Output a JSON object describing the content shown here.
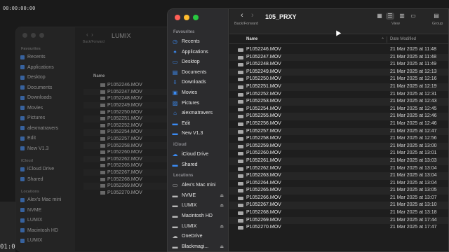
{
  "background": {
    "timecode_top": "00:00:00:00",
    "timecode_bottom": "01:0"
  },
  "back_window": {
    "title": "LUMIX",
    "back_forward_label": "Back/Forward",
    "column_name": "Name",
    "sidebar": [
      {
        "type": "head",
        "label": "Favourites"
      },
      {
        "type": "item",
        "label": "Recents"
      },
      {
        "type": "item",
        "label": "Applications"
      },
      {
        "type": "item",
        "label": "Desktop"
      },
      {
        "type": "item",
        "label": "Documents"
      },
      {
        "type": "item",
        "label": "Downloads"
      },
      {
        "type": "item",
        "label": "Movies"
      },
      {
        "type": "item",
        "label": "Pictures"
      },
      {
        "type": "item",
        "label": "alexmatravers"
      },
      {
        "type": "item",
        "label": "Edit"
      },
      {
        "type": "item",
        "label": "New V1.3"
      },
      {
        "type": "head",
        "label": "iCloud"
      },
      {
        "type": "item",
        "label": "iCloud Drive"
      },
      {
        "type": "item",
        "label": "Shared"
      },
      {
        "type": "head",
        "label": "Locations"
      },
      {
        "type": "item",
        "label": "Alex's Mac mini"
      },
      {
        "type": "item",
        "label": "NVME"
      },
      {
        "type": "item",
        "label": "LUMIX"
      },
      {
        "type": "item",
        "label": "Macintosh HD"
      },
      {
        "type": "item",
        "label": "LUMIX"
      }
    ],
    "files": [
      "P1052246.MOV",
      "P1052247.MOV",
      "P1052248.MOV",
      "P1052249.MOV",
      "P1052250.MOV",
      "P1052251.MOV",
      "P1052252.MOV",
      "P1052254.MOV",
      "P1052257.MOV",
      "P1052258.MOV",
      "P1052260.MOV",
      "P1052262.MOV",
      "P1052265.MOV",
      "P1052267.MOV",
      "P1052268.MOV",
      "P1052269.MOV",
      "P1052270.MOV"
    ]
  },
  "front_window": {
    "title": "105_PRXY",
    "back_forward_label": "Back/Forward",
    "view_label": "View",
    "group_label": "Group",
    "column_name": "Name",
    "column_date": "Date Modified",
    "sidebar": {
      "favourites_head": "Favourites",
      "favourites": [
        {
          "label": "Recents",
          "icon": "clock-icon"
        },
        {
          "label": "Applications",
          "icon": "applications-icon"
        },
        {
          "label": "Desktop",
          "icon": "desktop-icon"
        },
        {
          "label": "Documents",
          "icon": "document-icon"
        },
        {
          "label": "Downloads",
          "icon": "download-icon"
        },
        {
          "label": "Movies",
          "icon": "film-icon"
        },
        {
          "label": "Pictures",
          "icon": "picture-icon"
        },
        {
          "label": "alexmatravers",
          "icon": "home-icon"
        },
        {
          "label": "Edit",
          "icon": "folder-icon"
        },
        {
          "label": "New V1.3",
          "icon": "folder-icon"
        }
      ],
      "icloud_head": "iCloud",
      "icloud": [
        {
          "label": "iCloud Drive",
          "icon": "cloud-icon"
        },
        {
          "label": "Shared",
          "icon": "shared-folder-icon"
        }
      ],
      "locations_head": "Locations",
      "locations": [
        {
          "label": "Alex's Mac mini",
          "icon": "computer-icon",
          "eject": false
        },
        {
          "label": "NVME",
          "icon": "drive-icon",
          "eject": true
        },
        {
          "label": "LUMIX",
          "icon": "drive-icon",
          "eject": true
        },
        {
          "label": "Macintosh HD",
          "icon": "drive-icon",
          "eject": false
        },
        {
          "label": "LUMIX",
          "icon": "drive-icon",
          "eject": true
        },
        {
          "label": "OneDrive",
          "icon": "cloud-icon",
          "eject": false
        },
        {
          "label": "Blackmagi...",
          "icon": "drive-icon",
          "eject": true
        }
      ]
    },
    "files": [
      {
        "name": "P1052246.MOV",
        "date": "21 Mar 2025 at 11:48"
      },
      {
        "name": "P1052247.MOV",
        "date": "21 Mar 2025 at 11:48"
      },
      {
        "name": "P1052248.MOV",
        "date": "21 Mar 2025 at 11:49"
      },
      {
        "name": "P1052249.MOV",
        "date": "21 Mar 2025 at 12:13"
      },
      {
        "name": "P1052250.MOV",
        "date": "21 Mar 2025 at 12:16"
      },
      {
        "name": "P1052251.MOV",
        "date": "21 Mar 2025 at 12:19"
      },
      {
        "name": "P1052252.MOV",
        "date": "21 Mar 2025 at 12:31"
      },
      {
        "name": "P1052253.MOV",
        "date": "21 Mar 2025 at 12:43"
      },
      {
        "name": "P1052254.MOV",
        "date": "21 Mar 2025 at 12:45"
      },
      {
        "name": "P1052255.MOV",
        "date": "21 Mar 2025 at 12:46"
      },
      {
        "name": "P1052256.MOV",
        "date": "21 Mar 2025 at 12:46"
      },
      {
        "name": "P1052257.MOV",
        "date": "21 Mar 2025 at 12:47"
      },
      {
        "name": "P1052258.MOV",
        "date": "21 Mar 2025 at 12:56"
      },
      {
        "name": "P1052259.MOV",
        "date": "21 Mar 2025 at 13:00"
      },
      {
        "name": "P1052260.MOV",
        "date": "21 Mar 2025 at 13:01"
      },
      {
        "name": "P1052261.MOV",
        "date": "21 Mar 2025 at 13:03"
      },
      {
        "name": "P1052262.MOV",
        "date": "21 Mar 2025 at 13:04"
      },
      {
        "name": "P1052263.MOV",
        "date": "21 Mar 2025 at 13:04"
      },
      {
        "name": "P1052264.MOV",
        "date": "21 Mar 2025 at 13:04"
      },
      {
        "name": "P1052265.MOV",
        "date": "21 Mar 2025 at 13:05"
      },
      {
        "name": "P1052266.MOV",
        "date": "21 Mar 2025 at 13:07"
      },
      {
        "name": "P1052267.MOV",
        "date": "21 Mar 2025 at 13:10"
      },
      {
        "name": "P1052268.MOV",
        "date": "21 Mar 2025 at 13:18"
      },
      {
        "name": "P1052269.MOV",
        "date": "21 Mar 2025 at 17:44"
      },
      {
        "name": "P1052270.MOV",
        "date": "21 Mar 2025 at 17:47"
      }
    ]
  }
}
